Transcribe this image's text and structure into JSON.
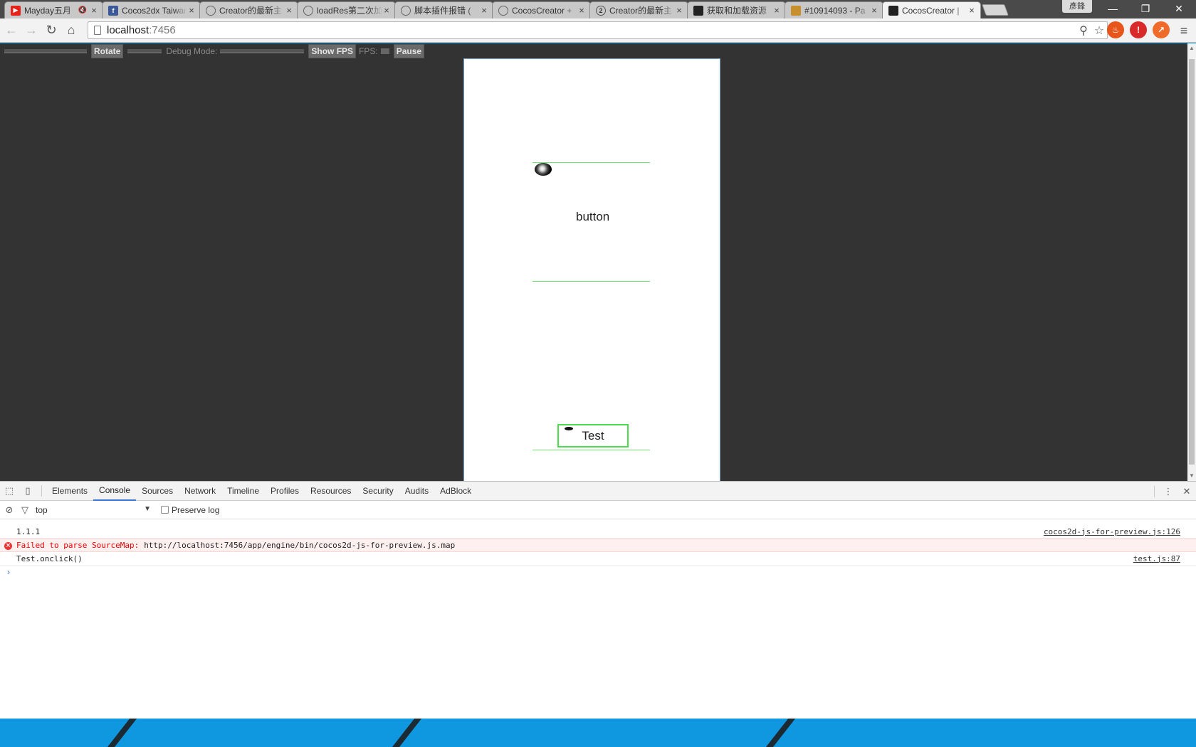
{
  "browser": {
    "tabs": [
      {
        "title": "Mayday五月",
        "favicon": "youtube-icon",
        "color": "#e62117",
        "extra": "🔇"
      },
      {
        "title": "Cocos2dx Taiwan",
        "favicon": "facebook-icon",
        "color": "#3b5998"
      },
      {
        "title": "Creator的最新主",
        "favicon": "forum-icon",
        "color": "#666666"
      },
      {
        "title": "loadRes第二次加",
        "favicon": "forum-icon",
        "color": "#666666"
      },
      {
        "title": "脚本插件报错 (",
        "favicon": "forum-icon",
        "color": "#666666"
      },
      {
        "title": "CocosCreator + ",
        "favicon": "forum-icon",
        "color": "#666666"
      },
      {
        "title": "Creator的最新主",
        "favicon": "forum-icon",
        "color": "#555555",
        "badge": "2"
      },
      {
        "title": "获取和加载资源",
        "favicon": "cocos-icon",
        "color": "#222222"
      },
      {
        "title": "#10914093 - Pa",
        "favicon": "page-icon",
        "color": "#c8902c"
      },
      {
        "title": "CocosCreator |",
        "favicon": "cocos-icon",
        "color": "#222222",
        "active": true
      }
    ],
    "profile_name": "彥鋒",
    "url_host": "localhost",
    "url_port": ":7456"
  },
  "debugbar": {
    "rotate_label": "Rotate",
    "debug_mode_label": "Debug Mode:",
    "show_fps_label": "Show FPS",
    "fps_label": "FPS:",
    "pause_label": "Pause"
  },
  "stage": {
    "button_label": "button",
    "test_label": "Test"
  },
  "devtools": {
    "tabs": [
      "Elements",
      "Console",
      "Sources",
      "Network",
      "Timeline",
      "Profiles",
      "Resources",
      "Security",
      "Audits",
      "AdBlock"
    ],
    "active_tab": "Console",
    "context": "top",
    "preserve_log_label": "Preserve log",
    "console": [
      {
        "text": "1.1.1",
        "source": "cocos2d-js-for-preview.js:126",
        "level": "log"
      },
      {
        "text": "Failed to parse SourceMap:",
        "url": "http://localhost:7456/app/engine/bin/cocos2d-js-for-preview.js.map",
        "level": "error"
      },
      {
        "text": "Test.onclick()",
        "source": "test.js:87",
        "level": "log"
      }
    ],
    "prompt": "›"
  },
  "colors": {
    "viewport_bg": "#333333",
    "guide_green": "#6fe36f",
    "error_red": "#e00000",
    "taskbar_blue": "#0f97e0"
  }
}
